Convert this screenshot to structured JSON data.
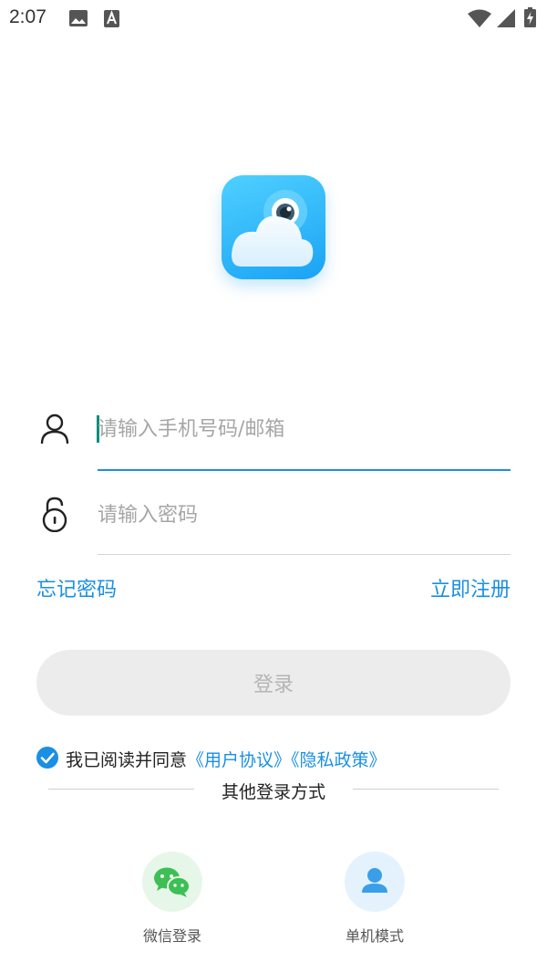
{
  "status_bar": {
    "time": "2:07",
    "icons": [
      "image-icon",
      "text-a-icon",
      "wifi-icon",
      "cell-signal-icon",
      "battery-charging-icon"
    ]
  },
  "logo": {
    "name": "cloud-camera-app-logo"
  },
  "login_form": {
    "phone_placeholder": "请输入手机号码/邮箱",
    "password_placeholder": "请输入密码",
    "forgot_password": "忘记密码",
    "register": "立即注册",
    "login_button": "登录"
  },
  "agreement": {
    "checked": true,
    "prefix": "我已阅读并同意",
    "user_agreement": "《用户协议》",
    "privacy_policy": "《隐私政策》"
  },
  "other_login": {
    "title": "其他登录方式",
    "options": [
      {
        "label": "微信登录",
        "icon": "wechat-icon"
      },
      {
        "label": "单机模式",
        "icon": "user-icon"
      }
    ]
  },
  "colors": {
    "accent": "#1a8fe3",
    "focus_line": "#1a8fe3",
    "wechat_green": "#3dbf55",
    "button_disabled_bg": "#ececec"
  }
}
